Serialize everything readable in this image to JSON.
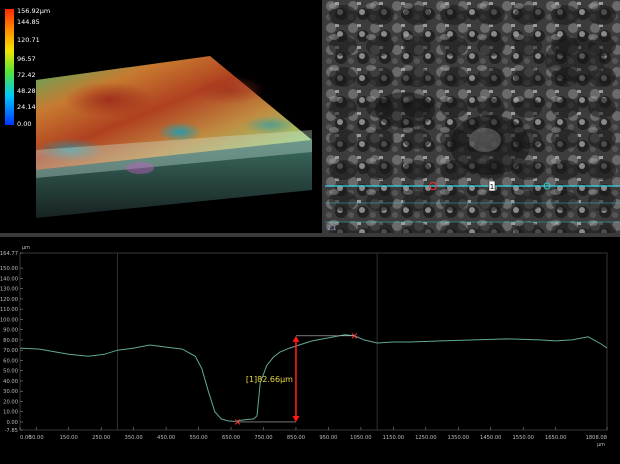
{
  "colorbar": {
    "ticks": [
      "156.92µm",
      "144.85",
      "120.71",
      "96.57",
      "72.42",
      "48.28",
      "24.14",
      "0.00"
    ]
  },
  "image_view": {
    "scale_label": "2.1",
    "marker_label": "1"
  },
  "chart_data": {
    "type": "line",
    "xunit": "µm",
    "yunit": "µm",
    "xlim": [
      0,
      1808.08
    ],
    "ylim": [
      -7.85,
      164.77
    ],
    "x_ticks": [
      "0.00",
      "50.00",
      "150.00",
      "250.00",
      "350.00",
      "450.00",
      "550.00",
      "650.00",
      "750.00",
      "850.00",
      "950.00",
      "1050.00",
      "1150.00",
      "1250.00",
      "1350.00",
      "1450.00",
      "1550.00",
      "1650.00",
      "1808.08"
    ],
    "y_ticks": [
      "164.77",
      "150.00",
      "140.00",
      "130.00",
      "120.00",
      "110.00",
      "100.00",
      "90.00",
      "80.00",
      "70.00",
      "60.00",
      "50.00",
      "40.00",
      "30.00",
      "20.00",
      "10.00",
      "0.00",
      "-7.85"
    ],
    "series": [
      {
        "x": [
          0,
          60,
          150,
          210,
          260,
          300,
          350,
          400,
          450,
          500,
          540,
          560,
          580,
          600,
          620,
          640,
          660,
          670,
          690,
          720,
          730,
          740,
          760,
          780,
          800,
          830,
          860,
          900,
          950,
          1000,
          1030,
          1060,
          1100,
          1150,
          1200,
          1300,
          1400,
          1500,
          1600,
          1650,
          1700,
          1750,
          1790,
          1808
        ],
        "y": [
          72,
          71,
          66,
          64,
          66,
          70,
          72,
          75,
          73,
          71,
          64,
          52,
          30,
          10,
          3,
          1,
          0.5,
          1,
          2,
          3,
          6,
          38,
          55,
          63,
          68,
          72,
          75,
          79,
          82,
          85,
          84,
          80,
          77,
          78,
          78,
          79,
          80,
          81,
          80,
          79,
          80,
          83,
          76,
          72
        ]
      }
    ],
    "markers": [
      {
        "x": 670,
        "y": 0
      },
      {
        "x": 1030,
        "y": 84
      }
    ],
    "measurement": {
      "label": "[1]82.66µm",
      "x": 850,
      "y_from": 0,
      "y_to": 84
    },
    "vertical_gridlines_x": [
      300,
      1100
    ]
  },
  "colors": {
    "profile_line": "#5fa898",
    "marker": "#ff3030",
    "measure_arrow": "#ff1a1a",
    "measure_text": "#e8d840",
    "grid": "#444444",
    "axis_text": "#bbbbbb"
  }
}
